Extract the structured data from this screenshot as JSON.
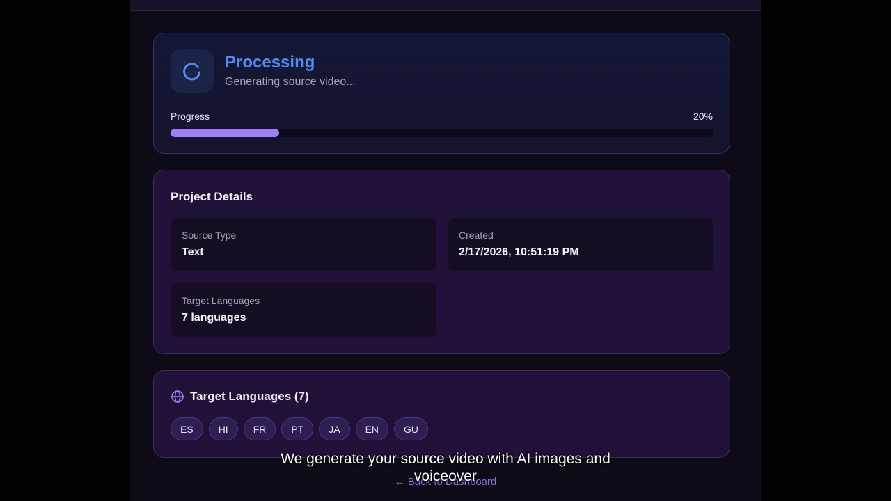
{
  "status": {
    "title": "Processing",
    "subtitle": "Generating source video...",
    "progress_label": "Progress",
    "progress_text": "20%",
    "progress_fraction": 0.2
  },
  "details": {
    "title": "Project Details",
    "source_type_label": "Source Type",
    "source_type_value": "Text",
    "created_label": "Created",
    "created_value": "2/17/2026, 10:51:19 PM",
    "target_languages_label": "Target Languages",
    "target_languages_value": "7 languages"
  },
  "languages": {
    "title": "Target Languages (7)",
    "icon": "globe-icon",
    "items": [
      "ES",
      "HI",
      "FR",
      "PT",
      "JA",
      "EN",
      "GU"
    ]
  },
  "back_link": "← Back to Dashboard",
  "caption": {
    "line1": "We generate your source video with AI images and",
    "line2": "voiceover"
  },
  "colors": {
    "accent_blue": "#4f8bf3",
    "accent_purple": "#a17ef3",
    "background": "#0f0a17"
  }
}
